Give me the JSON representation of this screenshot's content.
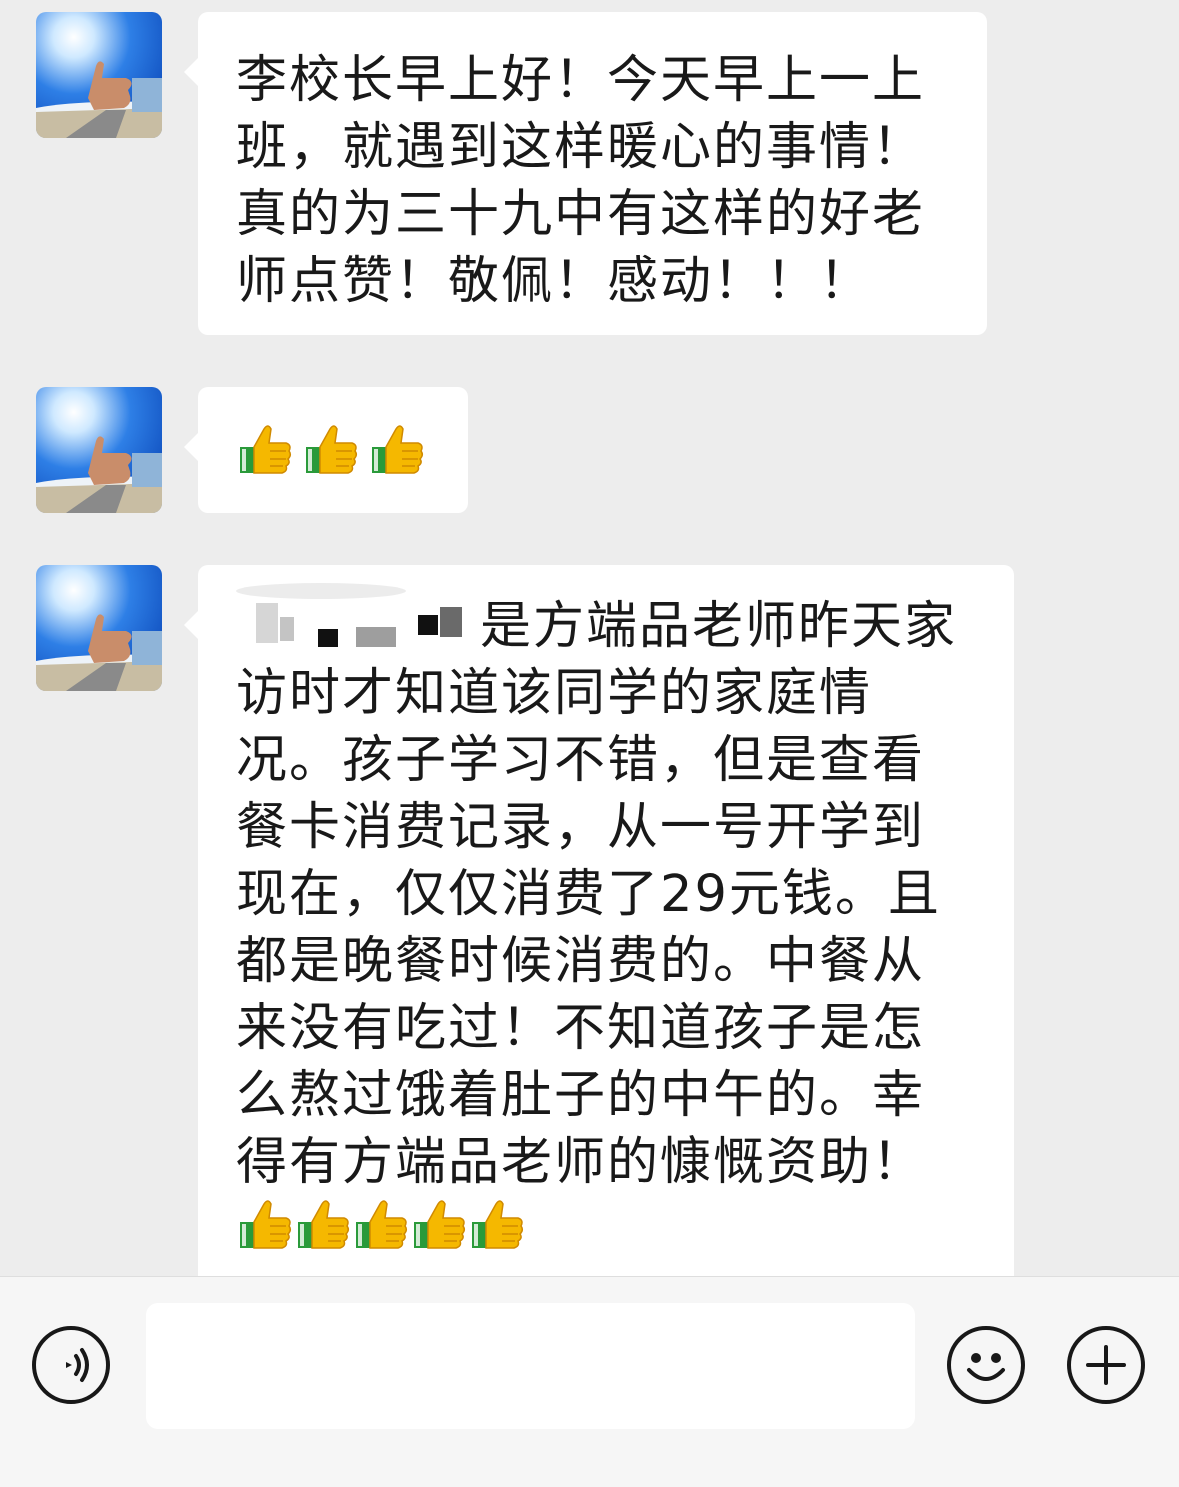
{
  "messages": [
    {
      "sender_avatar": "thumbs-up-sky-avatar",
      "text": "李校长早上好！今天早上一上班，就遇到这样暖心的事情！真的为三十九中有这样的好老师点赞！敬佩！感动！！！"
    },
    {
      "sender_avatar": "thumbs-up-sky-avatar",
      "emoji": [
        "thumbs-up",
        "thumbs-up",
        "thumbs-up"
      ]
    },
    {
      "sender_avatar": "thumbs-up-sky-avatar",
      "text_visible": "是方端品老师昨天家访时才知道该同学的家庭情况。孩子学习不错，但是查看餐卡消费记录，从一号开学到现在，仅仅消费了29元钱。且都是晚餐时候消费的。中餐从来没有吃过！不知道孩子是怎么熬过饿着肚子的中午的。幸得有方端品老师的慷慨资助！",
      "emoji_inline": [
        "thumbs-up",
        "thumbs-up",
        "thumbs-up"
      ],
      "emoji_end": [
        "thumbs-up",
        "thumbs-up"
      ]
    }
  ],
  "input_bar": {
    "voice_icon": "voice-icon",
    "input_placeholder": "",
    "emoji_icon": "emoji-icon",
    "plus_icon": "plus-icon"
  },
  "colors": {
    "background": "#ededed",
    "bubble": "#ffffff",
    "text": "#191919",
    "thumb_yellow": "#f5b800",
    "thumb_cuff": "#2a9a3a"
  }
}
